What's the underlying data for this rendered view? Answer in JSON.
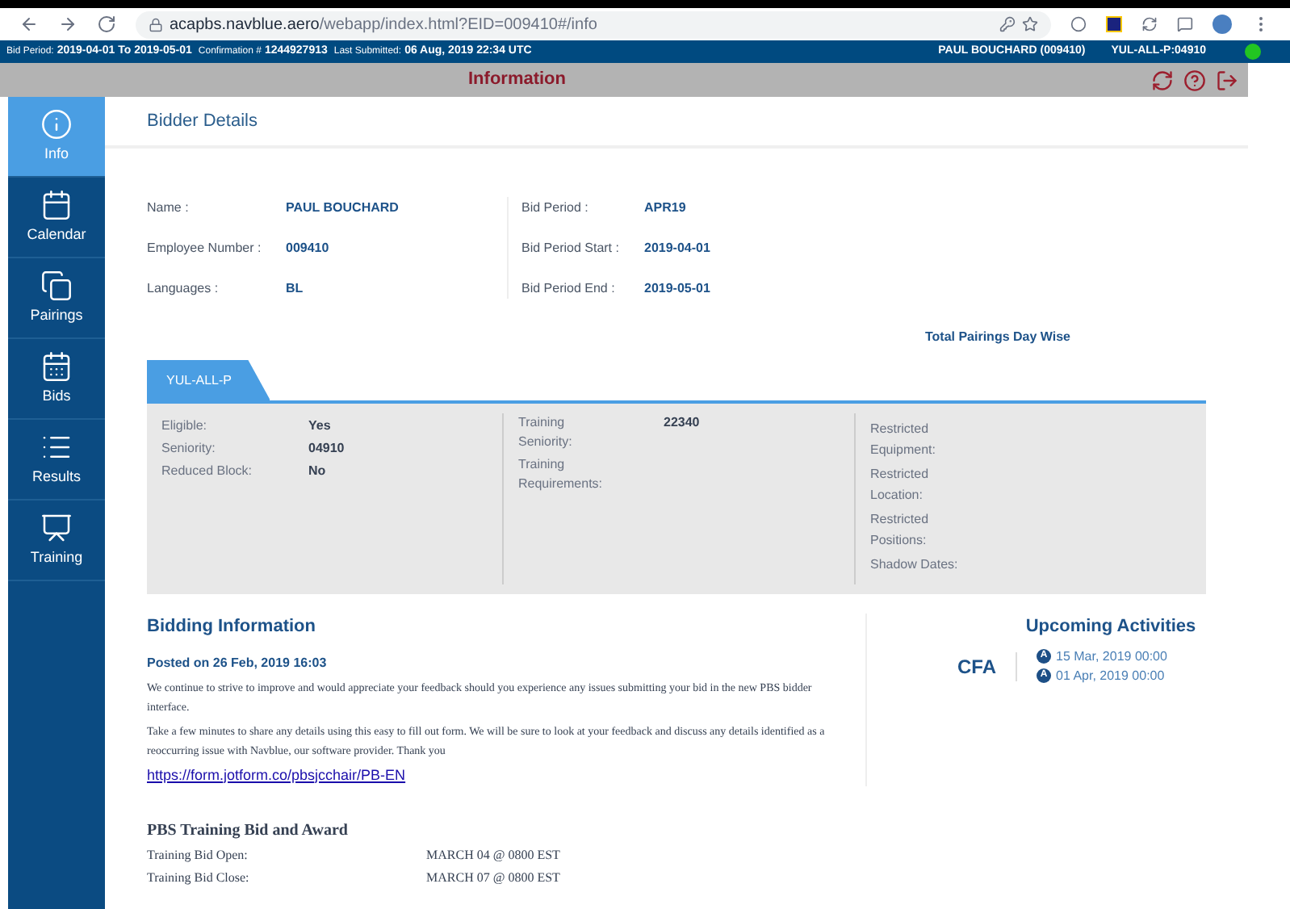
{
  "browser": {
    "url_host": "acapbs.navblue.aero",
    "url_path": "/webapp/index.html?EID=009410#/info"
  },
  "info_bar": {
    "items": [
      {
        "label": "Bid Period:",
        "value": "2019-04-01 To 2019-05-01"
      },
      {
        "label": "Confirmation #",
        "value": "1244927913"
      },
      {
        "label": "Last Submitted:",
        "value": "06 Aug, 2019 22:34 UTC"
      }
    ],
    "user": "PAUL BOUCHARD (009410)",
    "account": "YUL-ALL-P:04910",
    "online": true
  },
  "header": {
    "title": "Information"
  },
  "sidebar": {
    "items": [
      {
        "label": "Info",
        "selected": true
      },
      {
        "label": "Calendar",
        "selected": false
      },
      {
        "label": "Pairings",
        "selected": false
      },
      {
        "label": "Bids",
        "selected": false
      },
      {
        "label": "Results",
        "selected": false
      },
      {
        "label": "Training",
        "selected": false
      }
    ]
  },
  "bidder_details": {
    "title": "Bidder Details",
    "left": [
      {
        "label": "Name :",
        "value": "PAUL BOUCHARD"
      },
      {
        "label": "Employee Number :",
        "value": "009410"
      },
      {
        "label": "Languages :",
        "value": "BL"
      }
    ],
    "right": [
      {
        "label": "Bid Period :",
        "value": "APR19"
      },
      {
        "label": "Bid Period Start :",
        "value": "2019-04-01"
      },
      {
        "label": "Bid Period End :",
        "value": "2019-05-01"
      }
    ],
    "chart_title": "Total Pairings Day Wise"
  },
  "tabs": [
    {
      "label": "YUL-ALL-P",
      "selected": true
    }
  ],
  "panel": {
    "col1": [
      {
        "label": "Eligible:",
        "value": "Yes"
      },
      {
        "label": "Seniority:",
        "value": "04910"
      },
      {
        "label": "Reduced Block:",
        "value": "No"
      }
    ],
    "col2": [
      {
        "label": "Training Seniority:",
        "value": "22340"
      },
      {
        "label": "Training Requirements:"
      }
    ],
    "col3": [
      {
        "label": "Restricted Equipment:"
      },
      {
        "label": "Restricted Location:"
      },
      {
        "label": "Restricted Positions:"
      },
      {
        "label": "Shadow Dates:"
      }
    ]
  },
  "bidding_info": {
    "title": "Bidding Information",
    "posted": "Posted on 26 Feb, 2019 16:03",
    "paragraphs": [
      "We continue to strive to improve and would appreciate your feedback should you experience any issues submitting your bid in the new PBS bidder interface.",
      "Take a few minutes to share any details using this easy to fill out form. We will be sure to look at your feedback and discuss any details identified as a reoccurring issue with Navblue, our software provider. Thank you"
    ],
    "link": "https://form.jotform.co/pbsjcchair/PB-EN",
    "training_title": "PBS Training Bid and Award",
    "training_rows": [
      {
        "label": "Training Bid Open:",
        "value": "MARCH 04 @ 0800 EST"
      },
      {
        "label": "Training Bid Close:",
        "value": "MARCH 07 @ 0800 EST"
      }
    ]
  },
  "upcoming": {
    "title": "Upcoming Activities",
    "code": "CFA",
    "activities": [
      {
        "badge": "A",
        "date": "15 Mar, 2019 00:00"
      },
      {
        "badge": "A",
        "date": "01 Apr, 2019 00:00"
      }
    ]
  }
}
